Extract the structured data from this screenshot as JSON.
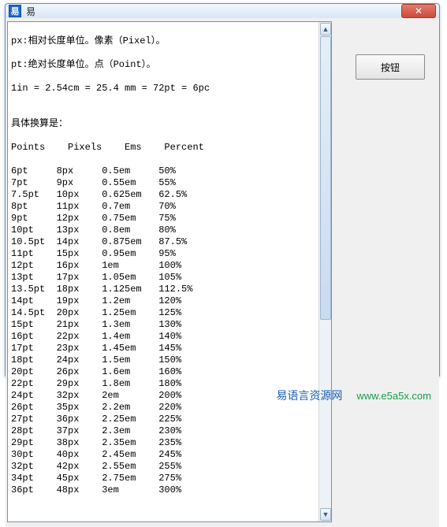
{
  "window": {
    "title": "易",
    "close_glyph": "✕"
  },
  "intro": {
    "line1": "px:相对长度单位。像素（Pixel）。",
    "line2": "pt:绝对长度单位。点（Point）。",
    "line3": "1in = 2.54cm = 25.4 mm = 72pt = 6pc",
    "line4": "",
    "line5": "具体换算是：",
    "header": "Points    Pixels    Ems    Percent"
  },
  "rows": [
    {
      "pt": "6pt",
      "px": "8px",
      "em": "0.5em",
      "pct": "50%"
    },
    {
      "pt": "7pt",
      "px": "9px",
      "em": "0.55em",
      "pct": "55%"
    },
    {
      "pt": "7.5pt",
      "px": "10px",
      "em": "0.625em",
      "pct": "62.5%"
    },
    {
      "pt": "8pt",
      "px": "11px",
      "em": "0.7em",
      "pct": "70%"
    },
    {
      "pt": "9pt",
      "px": "12px",
      "em": "0.75em",
      "pct": "75%"
    },
    {
      "pt": "10pt",
      "px": "13px",
      "em": "0.8em",
      "pct": "80%"
    },
    {
      "pt": "10.5pt",
      "px": "14px",
      "em": "0.875em",
      "pct": "87.5%"
    },
    {
      "pt": "11pt",
      "px": "15px",
      "em": "0.95em",
      "pct": "95%"
    },
    {
      "pt": "12pt",
      "px": "16px",
      "em": "1em",
      "pct": "100%"
    },
    {
      "pt": "13pt",
      "px": "17px",
      "em": "1.05em",
      "pct": "105%"
    },
    {
      "pt": "13.5pt",
      "px": "18px",
      "em": "1.125em",
      "pct": "112.5%"
    },
    {
      "pt": "14pt",
      "px": "19px",
      "em": "1.2em",
      "pct": "120%"
    },
    {
      "pt": "14.5pt",
      "px": "20px",
      "em": "1.25em",
      "pct": "125%"
    },
    {
      "pt": "15pt",
      "px": "21px",
      "em": "1.3em",
      "pct": "130%"
    },
    {
      "pt": "16pt",
      "px": "22px",
      "em": "1.4em",
      "pct": "140%"
    },
    {
      "pt": "17pt",
      "px": "23px",
      "em": "1.45em",
      "pct": "145%"
    },
    {
      "pt": "18pt",
      "px": "24px",
      "em": "1.5em",
      "pct": "150%"
    },
    {
      "pt": "20pt",
      "px": "26px",
      "em": "1.6em",
      "pct": "160%"
    },
    {
      "pt": "22pt",
      "px": "29px",
      "em": "1.8em",
      "pct": "180%"
    },
    {
      "pt": "24pt",
      "px": "32px",
      "em": "2em",
      "pct": "200%"
    },
    {
      "pt": "26pt",
      "px": "35px",
      "em": "2.2em",
      "pct": "220%"
    },
    {
      "pt": "27pt",
      "px": "36px",
      "em": "2.25em",
      "pct": "225%"
    },
    {
      "pt": "28pt",
      "px": "37px",
      "em": "2.3em",
      "pct": "230%"
    },
    {
      "pt": "29pt",
      "px": "38px",
      "em": "2.35em",
      "pct": "235%"
    },
    {
      "pt": "30pt",
      "px": "40px",
      "em": "2.45em",
      "pct": "245%"
    },
    {
      "pt": "32pt",
      "px": "42px",
      "em": "2.55em",
      "pct": "255%"
    },
    {
      "pt": "34pt",
      "px": "45px",
      "em": "2.75em",
      "pct": "275%"
    },
    {
      "pt": "36pt",
      "px": "48px",
      "em": "3em",
      "pct": "300%"
    }
  ],
  "button": {
    "label": "按钮"
  },
  "footer": {
    "brand": "易语言资源网",
    "url": "www.e5a5x.com"
  },
  "scroll": {
    "up": "▲",
    "down": "▼"
  }
}
